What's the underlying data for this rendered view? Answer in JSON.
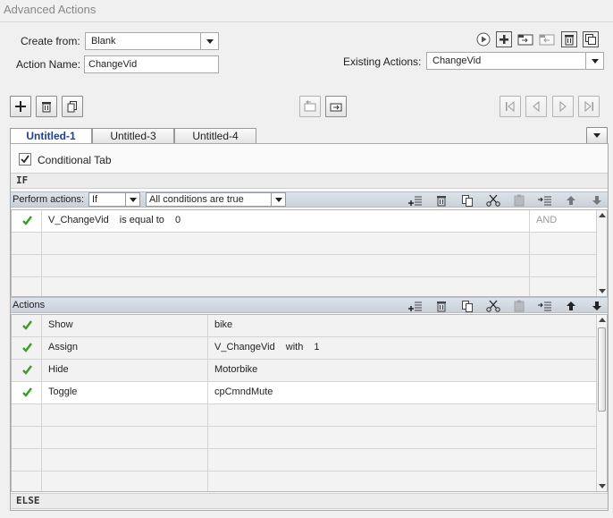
{
  "window": {
    "title": "Advanced Actions"
  },
  "form": {
    "create_from_label": "Create from:",
    "create_from_value": "Blank",
    "action_name_label": "Action Name:",
    "action_name_value": "ChangeVid",
    "existing_actions_label": "Existing Actions:",
    "existing_actions_value": "ChangeVid"
  },
  "top_icons": [
    "play-icon",
    "add-icon",
    "import-icon",
    "export-icon",
    "delete-icon",
    "duplicate-icon"
  ],
  "tabs": [
    {
      "label": "Untitled-1",
      "active": true
    },
    {
      "label": "Untitled-3",
      "active": false
    },
    {
      "label": "Untitled-4",
      "active": false
    }
  ],
  "conditional_tab": {
    "label": "Conditional Tab",
    "checked": true
  },
  "if_section": {
    "title": "IF",
    "perform_label": "Perform actions:",
    "perform_value": "If",
    "condition_mode": "All conditions are true",
    "rows": [
      {
        "checked": true,
        "variable": "V_ChangeVid",
        "operator": "is equal to",
        "value": "0",
        "logic": "AND"
      }
    ]
  },
  "actions_section": {
    "title": "Actions",
    "rows": [
      {
        "checked": true,
        "action": "Show",
        "target": "bike"
      },
      {
        "checked": true,
        "action": "Assign",
        "target": "V_ChangeVid",
        "with_label": "with",
        "with_value": "1"
      },
      {
        "checked": true,
        "action": "Hide",
        "target": "Motorbike"
      },
      {
        "checked": true,
        "action": "Toggle",
        "target": "cpCmndMute"
      }
    ]
  },
  "else_section": {
    "title": "ELSE"
  },
  "colors": {
    "active_tab": "#1b3fa0",
    "check": "#3aa022",
    "header_bar": "#cfd5dc"
  }
}
